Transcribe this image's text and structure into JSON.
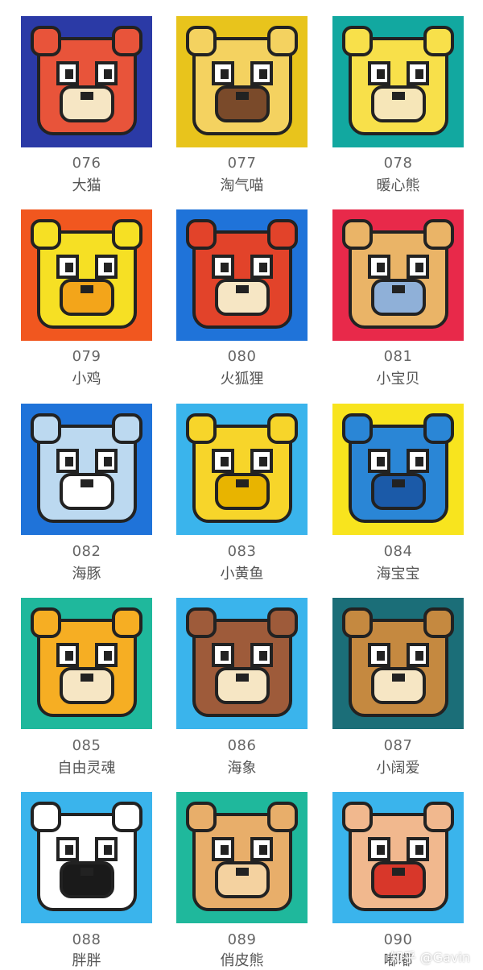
{
  "items": [
    {
      "number": "076",
      "name": "大猫",
      "bg": "#2b3aa6",
      "char": "#e8543a",
      "accent": "#f6e6c4",
      "icon": "tiger-icon"
    },
    {
      "number": "077",
      "name": "淘气喵",
      "bg": "#e8c41c",
      "char": "#f4d260",
      "accent": "#7a4a2a",
      "icon": "cat-icon"
    },
    {
      "number": "078",
      "name": "暖心熊",
      "bg": "#12a8a0",
      "char": "#f8e04a",
      "accent": "#f6e6b8",
      "icon": "bear-icon"
    },
    {
      "number": "079",
      "name": "小鸡",
      "bg": "#f1571f",
      "char": "#f6e024",
      "accent": "#f3a51a",
      "icon": "chick-icon"
    },
    {
      "number": "080",
      "name": "火狐狸",
      "bg": "#1f73d9",
      "char": "#e2432a",
      "accent": "#f6e6c4",
      "icon": "fox-icon"
    },
    {
      "number": "081",
      "name": "小宝贝",
      "bg": "#e8294a",
      "char": "#eab467",
      "accent": "#8fb0d8",
      "icon": "bear-icon"
    },
    {
      "number": "082",
      "name": "海豚",
      "bg": "#1f73d9",
      "char": "#bcd9f0",
      "accent": "#ffffff",
      "icon": "dolphin-icon"
    },
    {
      "number": "083",
      "name": "小黄鱼",
      "bg": "#3ab4ec",
      "char": "#f7d52a",
      "accent": "#e8b400",
      "icon": "fish-icon"
    },
    {
      "number": "084",
      "name": "海宝宝",
      "bg": "#f8e41e",
      "char": "#2a86d6",
      "accent": "#1b5aa8",
      "icon": "hippo-icon"
    },
    {
      "number": "085",
      "name": "自由灵魂",
      "bg": "#1fb89c",
      "char": "#f6ae23",
      "accent": "#f6e6c4",
      "icon": "fish-icon"
    },
    {
      "number": "086",
      "name": "海象",
      "bg": "#3ab4ec",
      "char": "#9e5b3a",
      "accent": "#f6e6c4",
      "icon": "walrus-icon"
    },
    {
      "number": "087",
      "name": "小阔爱",
      "bg": "#1b6e78",
      "char": "#c58940",
      "accent": "#f6e6c4",
      "icon": "dog-icon"
    },
    {
      "number": "088",
      "name": "胖胖",
      "bg": "#3ab4ec",
      "char": "#ffffff",
      "accent": "#1a1a1a",
      "icon": "panda-icon"
    },
    {
      "number": "089",
      "name": "俏皮熊",
      "bg": "#1fb89c",
      "char": "#e8ae6a",
      "accent": "#f4d2a0",
      "icon": "lion-icon"
    },
    {
      "number": "090",
      "name": "嘟嘟",
      "bg": "#3ab4ec",
      "char": "#f1b88e",
      "accent": "#d8372a",
      "icon": "baby-icon"
    }
  ],
  "watermark": "知乎 @Gavin"
}
